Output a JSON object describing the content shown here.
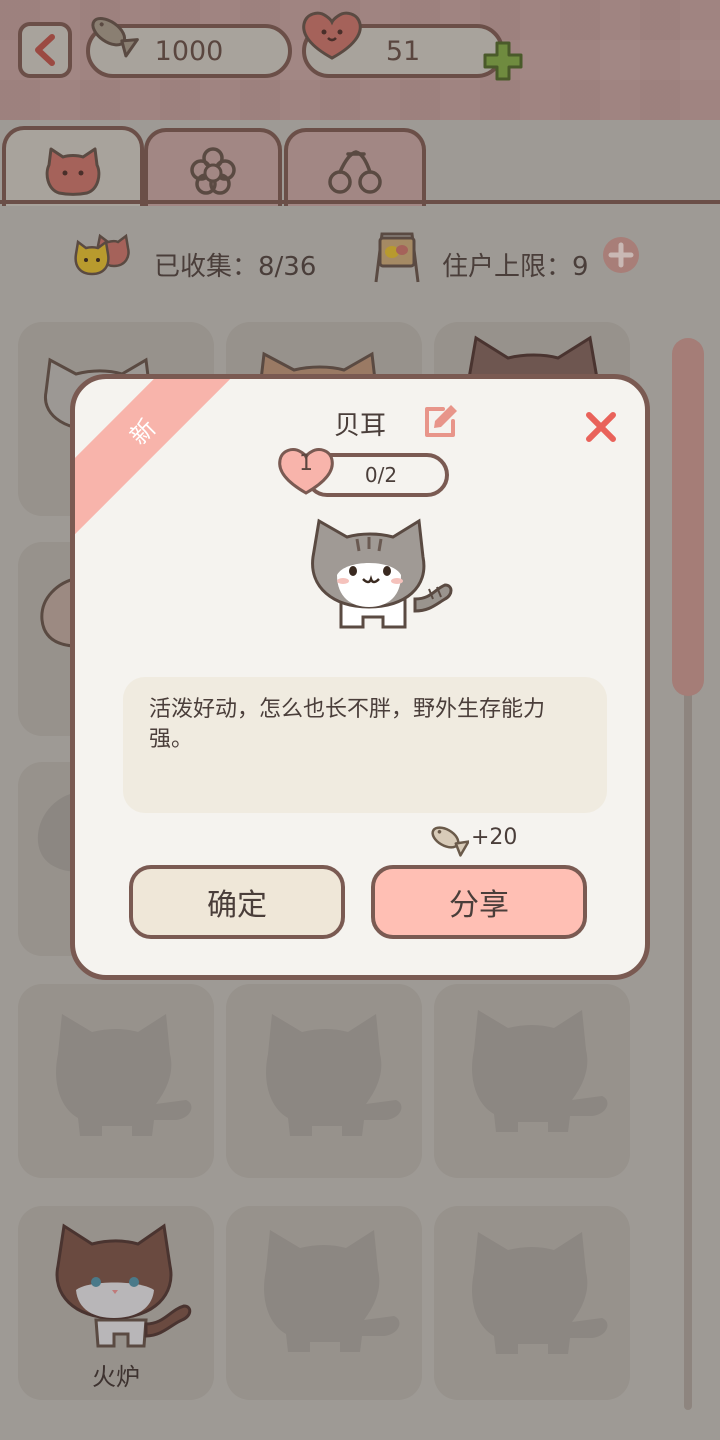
{
  "currency": {
    "fish": "1000",
    "hearts": "51"
  },
  "tabs": [
    {
      "icon": "cat-face-icon",
      "active": true
    },
    {
      "icon": "flower-icon",
      "active": false
    },
    {
      "icon": "cherry-icon",
      "active": false
    }
  ],
  "stats": {
    "collected": "已收集：8/36",
    "residents": "住户上限：9"
  },
  "grid": {
    "visible_name": "火炉"
  },
  "modal": {
    "badge": "新",
    "cat_name": "贝耳",
    "level": "1",
    "progress": "0/2",
    "description": "活泼好动，怎么也长不胖，野外生存能力强。",
    "reward": "+20",
    "confirm_label": "确定",
    "share_label": "分享"
  },
  "colors": {
    "accent": "#ffbfb4",
    "border": "#7a5a52",
    "close": "#e9625a",
    "plus": "#7fb54a"
  }
}
